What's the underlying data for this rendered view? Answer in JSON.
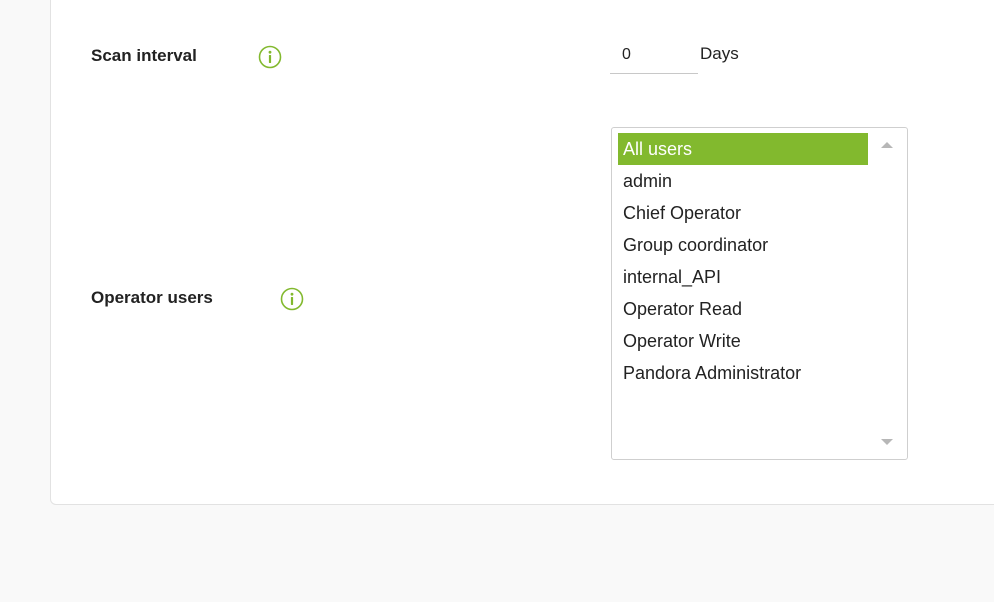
{
  "form": {
    "scan_interval": {
      "label": "Scan interval",
      "value": "0",
      "unit": "Days"
    },
    "operator_users": {
      "label": "Operator users",
      "options": [
        {
          "label": "All users",
          "selected": true
        },
        {
          "label": "admin",
          "selected": false
        },
        {
          "label": "Chief Operator",
          "selected": false
        },
        {
          "label": "Group coordinator",
          "selected": false
        },
        {
          "label": "internal_API",
          "selected": false
        },
        {
          "label": "Operator Read",
          "selected": false
        },
        {
          "label": "Operator Write",
          "selected": false
        },
        {
          "label": "Pandora Administrator",
          "selected": false
        }
      ]
    }
  },
  "colors": {
    "accent": "#82b92e",
    "panel_background": "#ffffff",
    "page_background": "#f9f9f9"
  },
  "icons": {
    "help": "info-icon",
    "scroll_up": "chevron-up-icon",
    "scroll_down": "chevron-down-icon"
  }
}
